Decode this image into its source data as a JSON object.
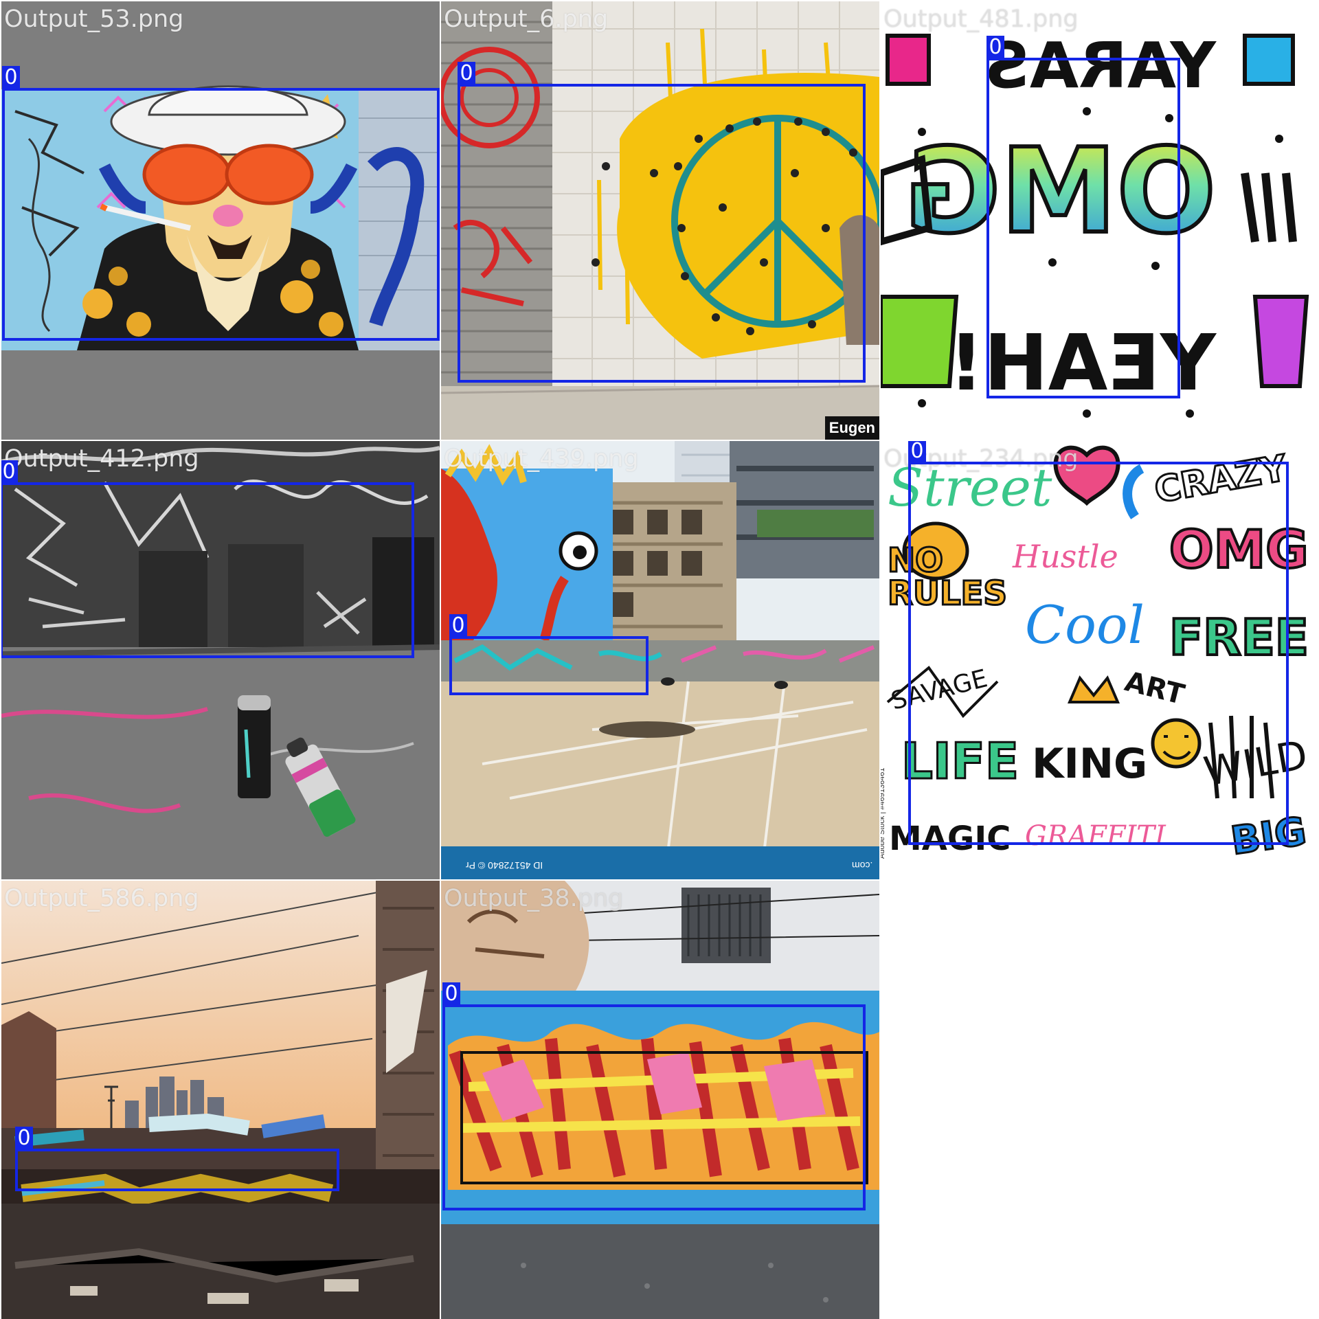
{
  "tiles": [
    {
      "filename": "Output_53.png",
      "box_label": "0"
    },
    {
      "filename": "Output_6.png",
      "box_label": "0",
      "watermark": "Eugen"
    },
    {
      "filename": "Output_481.png",
      "box_label": "0"
    },
    {
      "filename": "Output_412.png",
      "box_label": "0"
    },
    {
      "filename": "Output_439.png",
      "box_label": "0",
      "stock_id": "ID 45172840 © Pr",
      "stock_domain": ".com"
    },
    {
      "filename": "Output_234.png",
      "box_label": "0",
      "stock_credit": "Adobe Stock | #469136461",
      "words": [
        "Street",
        "CRAZY",
        "NO RULES",
        "Hustle",
        "OMG",
        "Cool",
        "FREE",
        "SAVAGE",
        "ART",
        "LIFE",
        "KING",
        "WILD",
        "MAGIC",
        "GRAFFITI",
        "BIG"
      ]
    },
    {
      "filename": "Output_586.png",
      "box_label": "0"
    },
    {
      "filename": "Output_38.png",
      "box_label": "0"
    }
  ],
  "colors": {
    "box": "#1426e6",
    "label_text": "#ffffff",
    "background": "#ffffff"
  }
}
